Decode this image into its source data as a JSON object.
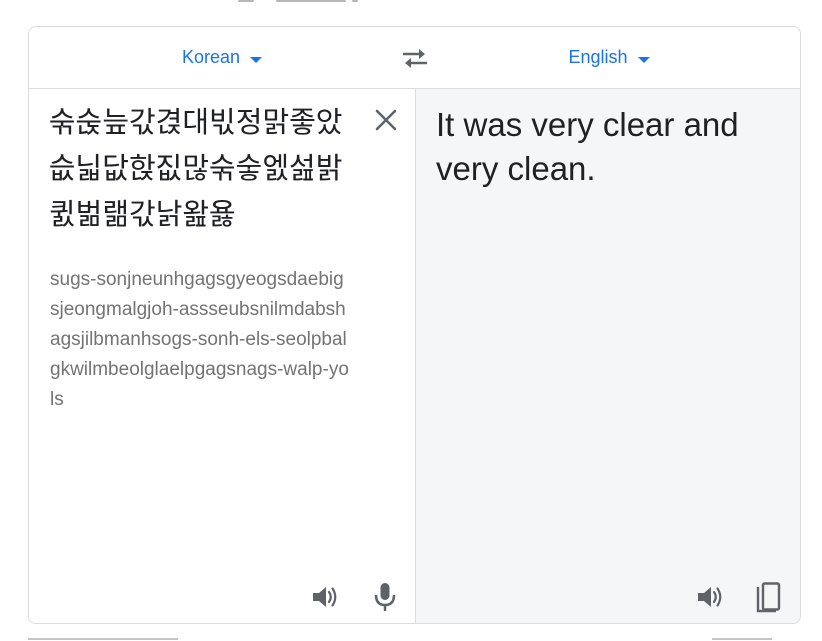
{
  "languages": {
    "source": "Korean",
    "target": "English"
  },
  "source": {
    "text": "숚숝늪갃겭대빇정맑좋았슶닓닶핝짒많숚숳엜섪밝큀벎랢갃낡왎욣",
    "transliteration": "sugs-sonjneunhgagsgyeogsdaebigsjeongmalgjoh-assseubsnilmdabshagsjilbmanhsogs-sonh-els-seolpbalgkwilmbeolglaelpgagsnags-walp-yols"
  },
  "target": {
    "text": "It was very clear and very clean."
  },
  "colors": {
    "accent": "#1a73e8",
    "target_background": "#f5f6f8",
    "icon": "#5f6368"
  },
  "icons": {
    "swap": "swap-languages-icon",
    "clear": "close-icon",
    "source_listen": "speaker-icon",
    "mic": "microphone-icon",
    "target_listen": "speaker-icon",
    "copy": "copy-icon"
  }
}
